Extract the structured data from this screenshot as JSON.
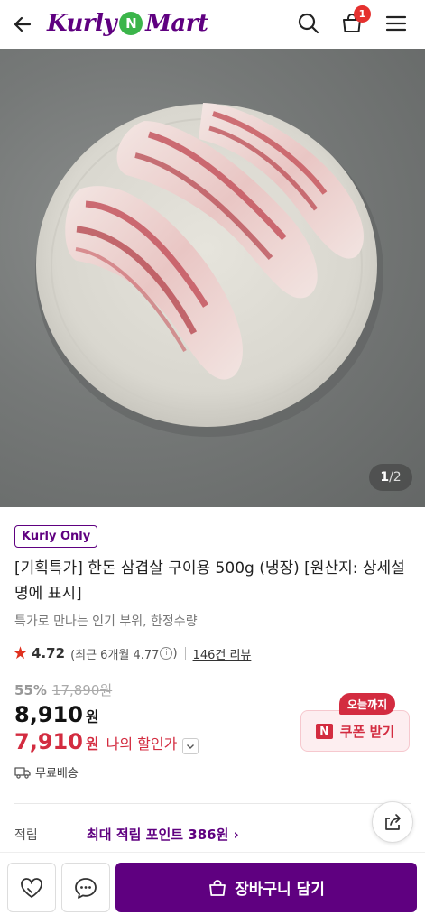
{
  "header": {
    "logo_left": "Kurly",
    "logo_mid": "N",
    "logo_right": "Mart",
    "cart_count": "1"
  },
  "hero": {
    "pager_current": "1",
    "pager_total": "/2"
  },
  "product": {
    "badge": "Kurly Only",
    "title": "[기획특가] 한돈 삼겹살 구이용 500g (냉장) [원산지: 상세설명에 표시]",
    "subtitle": "특가로 만나는 인기 부위, 한정수량",
    "rating": "4.72",
    "recent_rating": "(최근 6개월 4.77",
    "recent_close": ")",
    "info_icon": "i",
    "reviews": "146건 리뷰",
    "discount_rate": "55%",
    "original_price": "17,890원",
    "price": "8,910",
    "price_unit": "원",
    "my_price": "7,910",
    "my_price_unit": "원",
    "my_price_label": "나의 할인가",
    "coupon_tag": "오늘까지",
    "coupon_logo": "N",
    "coupon_label": "쿠폰 받기",
    "delivery": "무료배송",
    "points_label": "적립",
    "points_value": "최대 적립 포인트 386원 ›"
  },
  "bottom_bar": {
    "add_to_cart": "장바구니 담기"
  },
  "colors": {
    "brand_purple": "#5f0080",
    "sale_red": "#d32c40",
    "badge_red": "#e5302e",
    "naver_green": "#3bb54a"
  },
  "icons": [
    "back-arrow-icon",
    "search-icon",
    "shopping-bag-icon",
    "hamburger-menu-icon",
    "star-icon",
    "info-icon",
    "chevron-down-icon",
    "truck-icon",
    "share-icon",
    "heart-icon",
    "chat-icon"
  ]
}
